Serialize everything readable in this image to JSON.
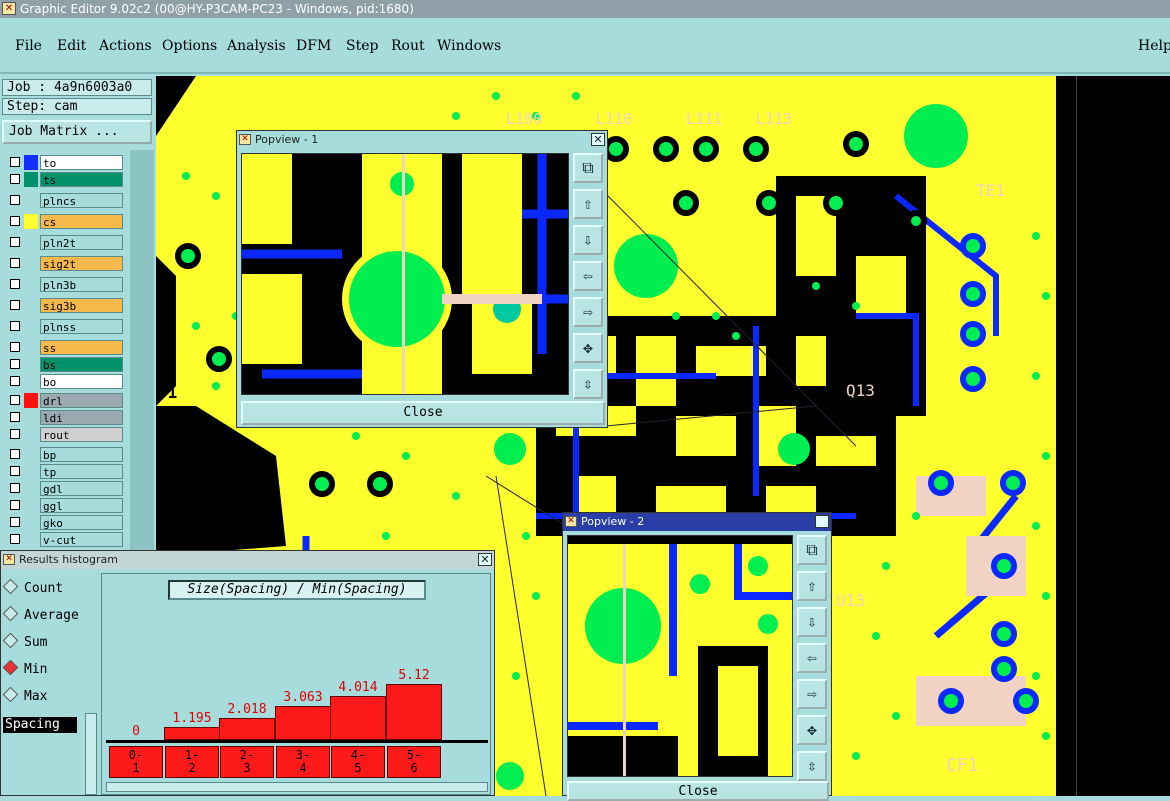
{
  "window": {
    "title": "Graphic Editor 9.02c2 (00@HY-P3CAM-PC23 - Windows, pid:1680)"
  },
  "menu": {
    "file": "File",
    "edit": "Edit",
    "actions": "Actions",
    "options": "Options",
    "analysis": "Analysis",
    "dfm": "DFM",
    "step": "Step",
    "rout": "Rout",
    "windows": "Windows",
    "help": "Help"
  },
  "job": {
    "job": "Job : 4a9n6003a0",
    "step": "Step: cam",
    "matrix": "Job Matrix ..."
  },
  "layers": [
    {
      "name": "to",
      "swatch": "#1030ff",
      "bg": "#ffffff"
    },
    {
      "name": "ts",
      "swatch": "#00906a",
      "bg": "#00906a"
    },
    {
      "name": "plncs",
      "swatch": "",
      "bg": "#a6dcdc"
    },
    {
      "name": "cs",
      "swatch": "#ffff30",
      "bg": "#f7b94c"
    },
    {
      "name": "pln2t",
      "swatch": "",
      "bg": "#a6dcdc"
    },
    {
      "name": "sig2t",
      "swatch": "",
      "bg": "#f7b94c"
    },
    {
      "name": "pln3b",
      "swatch": "",
      "bg": "#a6dcdc"
    },
    {
      "name": "sig3b",
      "swatch": "",
      "bg": "#f7b94c"
    },
    {
      "name": "plnss",
      "swatch": "",
      "bg": "#a6dcdc"
    },
    {
      "name": "ss",
      "swatch": "",
      "bg": "#f7b94c"
    },
    {
      "name": "bs",
      "swatch": "",
      "bg": "#00906a"
    },
    {
      "name": "bo",
      "swatch": "",
      "bg": "#ffffff"
    },
    {
      "name": "drl",
      "swatch": "#ff1010",
      "bg": "#9aa8b0"
    },
    {
      "name": "ldi",
      "swatch": "",
      "bg": "#9aa8b0"
    },
    {
      "name": "rout",
      "swatch": "",
      "bg": "#d0d0d0"
    },
    {
      "name": "bp",
      "swatch": "",
      "bg": "#a6dcdc"
    },
    {
      "name": "tp",
      "swatch": "",
      "bg": "#a6dcdc"
    },
    {
      "name": "gdl",
      "swatch": "",
      "bg": "#a6dcdc"
    },
    {
      "name": "ggl",
      "swatch": "",
      "bg": "#a6dcdc"
    },
    {
      "name": "gko",
      "swatch": "",
      "bg": "#a6dcdc"
    },
    {
      "name": "v-cut",
      "swatch": "",
      "bg": "#a6dcdc"
    }
  ],
  "popview1": {
    "title": "Popview - 1",
    "close": "Close",
    "close_x": "✕"
  },
  "popview2": {
    "title": "Popview - 2",
    "close": "Close",
    "close_x": "✕"
  },
  "results": {
    "title": "Results histogram",
    "close_x": "✕",
    "options": [
      {
        "label": "Count",
        "selected": false
      },
      {
        "label": "Average",
        "selected": false
      },
      {
        "label": "Sum",
        "selected": false
      },
      {
        "label": "Min",
        "selected": true
      },
      {
        "label": "Max",
        "selected": false
      }
    ],
    "field": "Spacing",
    "histogram_title": "Size(Spacing) / Min(Spacing)"
  },
  "chart_data": {
    "type": "bar",
    "title": "Size(Spacing) / Min(Spacing)",
    "categories": [
      "0-\n1",
      "1-\n2",
      "2-\n3",
      "3-\n4",
      "4-\n5",
      "5-\n6"
    ],
    "values": [
      0,
      1.195,
      2.018,
      3.063,
      4.014,
      5.12
    ],
    "value_labels": [
      "0",
      "1.195",
      "2.018",
      "3.063",
      "4.014",
      "5.12"
    ]
  },
  "board_labels": {
    "l100": "L100",
    "l110": "L110",
    "l111": "L111",
    "l113": "L113",
    "te": "TE1",
    "q13": "Q13",
    "cf1": "CF1",
    "u13": "U13",
    "r1": ".1"
  },
  "colors": {
    "yellow": "#ffff2e",
    "green": "#00ee50",
    "blue": "#0a28ff",
    "pink": "#f2d2c2",
    "black": "#000000"
  }
}
